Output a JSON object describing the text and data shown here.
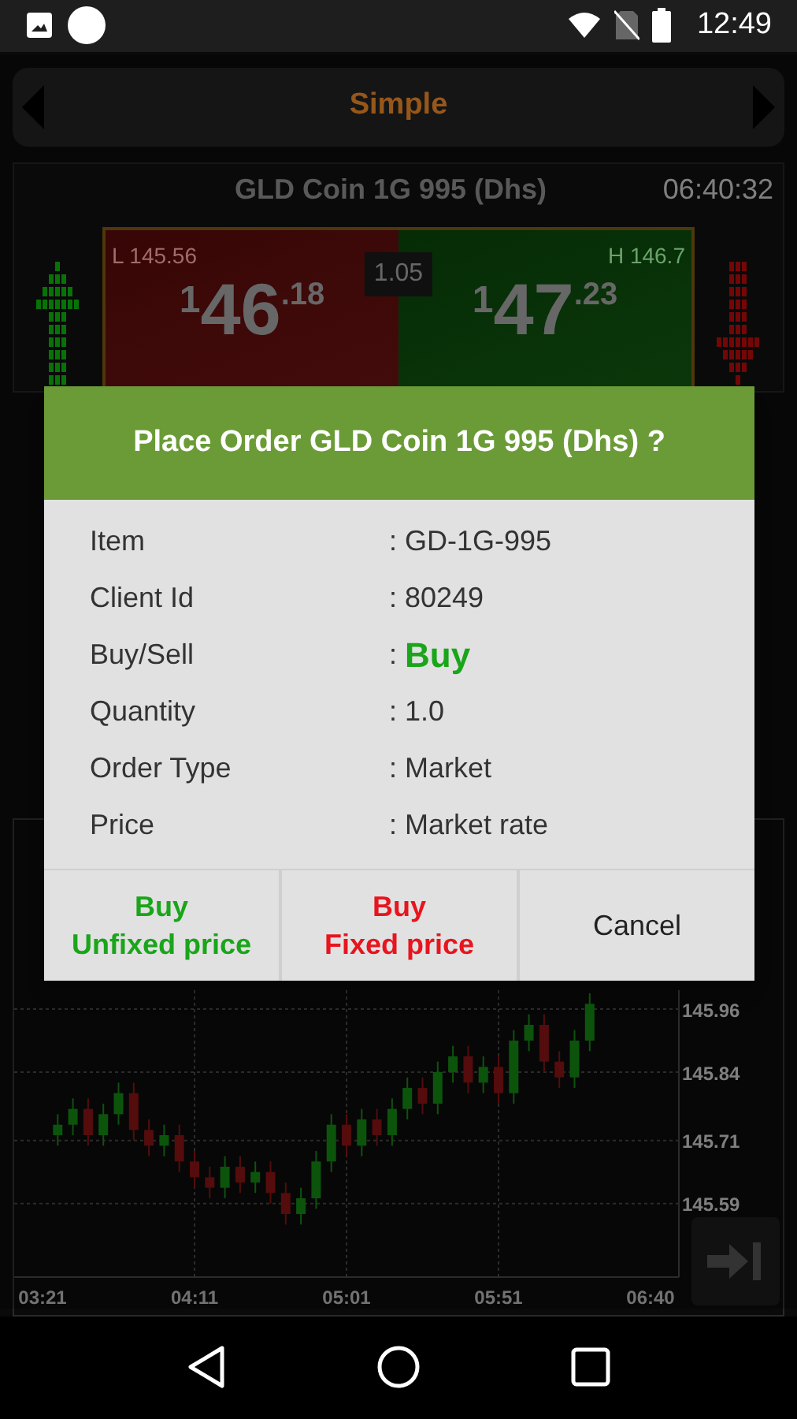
{
  "status_bar": {
    "time": "12:49"
  },
  "mode_bar": {
    "label": "Simple"
  },
  "quote": {
    "title": "GLD Coin 1G 995 (Dhs)",
    "time": "06:40:32",
    "low": "L 145.56",
    "high": "H 146.7",
    "spread": "1.05",
    "bid": {
      "lead": "1",
      "big": "46",
      "decimals": ".18"
    },
    "ask": {
      "lead": "1",
      "big": "47",
      "decimals": ".23"
    }
  },
  "chart": {
    "chart_data": {
      "type": "candlestick",
      "grid": true,
      "ylim": [
        145.45,
        146.32
      ],
      "yticks": [
        145.96,
        145.84,
        145.71,
        145.59
      ],
      "categories": [
        "03:21",
        null,
        null,
        null,
        null,
        null,
        null,
        null,
        null,
        null,
        "04:11",
        null,
        null,
        null,
        null,
        null,
        null,
        null,
        null,
        null,
        "05:01",
        null,
        null,
        null,
        null,
        null,
        null,
        null,
        null,
        null,
        "05:51",
        null,
        null,
        null,
        null,
        null,
        null,
        null,
        null,
        null,
        "06:40"
      ],
      "ohlc": [
        null,
        [
          145.72,
          145.76,
          145.7,
          145.74
        ],
        [
          145.74,
          145.79,
          145.72,
          145.77
        ],
        [
          145.77,
          145.79,
          145.7,
          145.72
        ],
        [
          145.72,
          145.78,
          145.7,
          145.76
        ],
        [
          145.76,
          145.82,
          145.74,
          145.8
        ],
        [
          145.8,
          145.82,
          145.71,
          145.73
        ],
        [
          145.73,
          145.75,
          145.68,
          145.7
        ],
        [
          145.7,
          145.74,
          145.68,
          145.72
        ],
        [
          145.72,
          145.74,
          145.65,
          145.67
        ],
        [
          145.67,
          145.69,
          145.62,
          145.64
        ],
        [
          145.64,
          145.66,
          145.6,
          145.62
        ],
        [
          145.62,
          145.68,
          145.6,
          145.66
        ],
        [
          145.66,
          145.68,
          145.61,
          145.63
        ],
        [
          145.63,
          145.67,
          145.61,
          145.65
        ],
        [
          145.65,
          145.67,
          145.59,
          145.61
        ],
        [
          145.61,
          145.63,
          145.55,
          145.57
        ],
        [
          145.57,
          145.62,
          145.55,
          145.6
        ],
        [
          145.6,
          145.69,
          145.58,
          145.67
        ],
        [
          145.67,
          145.76,
          145.65,
          145.74
        ],
        [
          145.74,
          145.76,
          145.68,
          145.7
        ],
        [
          145.7,
          145.77,
          145.68,
          145.75
        ],
        [
          145.75,
          145.77,
          145.7,
          145.72
        ],
        [
          145.72,
          145.79,
          145.7,
          145.77
        ],
        [
          145.77,
          145.83,
          145.75,
          145.81
        ],
        [
          145.81,
          145.83,
          145.76,
          145.78
        ],
        [
          145.78,
          145.86,
          145.76,
          145.84
        ],
        [
          145.84,
          145.89,
          145.82,
          145.87
        ],
        [
          145.87,
          145.89,
          145.8,
          145.82
        ],
        [
          145.82,
          145.87,
          145.8,
          145.85
        ],
        [
          145.85,
          145.87,
          145.78,
          145.8
        ],
        [
          145.8,
          145.92,
          145.78,
          145.9
        ],
        [
          145.9,
          145.95,
          145.88,
          145.93
        ],
        [
          145.93,
          145.95,
          145.84,
          145.86
        ],
        [
          145.86,
          145.88,
          145.81,
          145.83
        ],
        [
          145.83,
          145.92,
          145.81,
          145.9
        ],
        [
          145.9,
          145.99,
          145.88,
          145.97
        ],
        null,
        null,
        null,
        null
      ]
    }
  },
  "dialog": {
    "title": "Place Order GLD Coin 1G 995 (Dhs) ?",
    "rows": [
      {
        "label": "Item",
        "colon": ":",
        "value": "GD-1G-995",
        "kind": "plain"
      },
      {
        "label": "Client Id",
        "colon": ":",
        "value": "80249",
        "kind": "plain"
      },
      {
        "label": "Buy/Sell",
        "colon": ":",
        "value": "Buy",
        "kind": "side"
      },
      {
        "label": "Quantity",
        "colon": ":",
        "value": "1.0",
        "kind": "plain"
      },
      {
        "label": "Order Type",
        "colon": ":",
        "value": "Market",
        "kind": "plain"
      },
      {
        "label": "Price",
        "colon": ":",
        "value": "Market rate",
        "kind": "plain"
      }
    ],
    "buttons": [
      {
        "lines": [
          "Buy",
          "Unfixed price"
        ],
        "kind": "buy"
      },
      {
        "lines": [
          "Buy",
          "Fixed price"
        ],
        "kind": "sell"
      },
      {
        "lines": [
          "Cancel"
        ],
        "kind": "plain"
      }
    ]
  }
}
